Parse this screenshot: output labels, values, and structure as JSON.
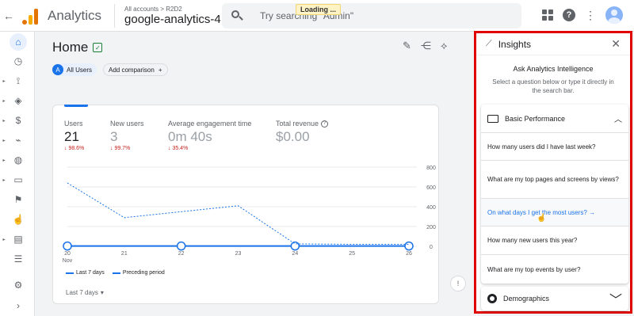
{
  "app": {
    "name": "Analytics"
  },
  "account": {
    "crumbs": "All accounts > R2D2",
    "property": "google-analytics-4"
  },
  "search": {
    "placeholder": "Try searching \"Admin\"",
    "overlay": "Loading ..."
  },
  "nav": {
    "items": [
      {
        "name": "home",
        "icon": "home-icon"
      },
      {
        "name": "realtime",
        "icon": "clock-icon"
      },
      {
        "name": "explore",
        "icon": "explore-icon"
      },
      {
        "name": "tags",
        "icon": "tag-icon"
      },
      {
        "name": "monetization",
        "icon": "dollar-icon"
      },
      {
        "name": "engagement",
        "icon": "wand-icon"
      },
      {
        "name": "acquisition",
        "icon": "globe-icon"
      },
      {
        "name": "tech",
        "icon": "devices-icon"
      },
      {
        "name": "flag",
        "icon": "flag-icon"
      },
      {
        "name": "user",
        "icon": "hand-icon"
      },
      {
        "name": "reports",
        "icon": "report-icon"
      },
      {
        "name": "configure",
        "icon": "list-icon"
      },
      {
        "name": "settings",
        "icon": "gear-icon"
      },
      {
        "name": "collapse",
        "icon": "chevron-right-icon"
      }
    ]
  },
  "home": {
    "title": "Home",
    "chips": {
      "users_initial": "A",
      "users": "All Users",
      "add_comparison": "Add comparison"
    }
  },
  "card": {
    "metrics": [
      {
        "label": "Users",
        "value": "21",
        "change": "↓ 98.6%"
      },
      {
        "label": "New users",
        "value": "3",
        "change": "↓ 99.7%"
      },
      {
        "label": "Average engagement time",
        "value": "0m 40s",
        "change": "↓ 35.4%"
      },
      {
        "label": "Total revenue",
        "value": "$0.00",
        "change": ""
      }
    ],
    "legend": {
      "current": "Last 7 days",
      "previous": "Preceding period"
    },
    "footer": "Last 7 days"
  },
  "chart_data": {
    "type": "line",
    "x": [
      "20 Nov",
      "21",
      "22",
      "23",
      "24",
      "25",
      "26"
    ],
    "x_ticks": [
      "20",
      "21",
      "22",
      "23",
      "24",
      "25",
      "26"
    ],
    "x_month": "Nov",
    "ylim": [
      0,
      800
    ],
    "y_ticks": [
      "800",
      "600",
      "400",
      "200",
      "0"
    ],
    "series": [
      {
        "name": "Last 7 days",
        "style": "solid",
        "values": [
          3,
          3,
          3,
          3,
          3,
          3,
          3
        ]
      },
      {
        "name": "Preceding period",
        "style": "dashed",
        "values": [
          640,
          290,
          null,
          410,
          25,
          20,
          20
        ]
      }
    ],
    "color": "#1a73e8",
    "grid": true
  },
  "panel": {
    "title": "Insights",
    "ask_title": "Ask Analytics Intelligence",
    "ask_sub": "Select a question below or type it directly in the search bar.",
    "section": "Basic Performance",
    "questions": [
      "How many users did I have last week?",
      "What are my top pages and screens by views?",
      "On what days I get the most users? →",
      "How many new users this year?",
      "What are my top events by user?"
    ],
    "demographics": "Demographics"
  }
}
